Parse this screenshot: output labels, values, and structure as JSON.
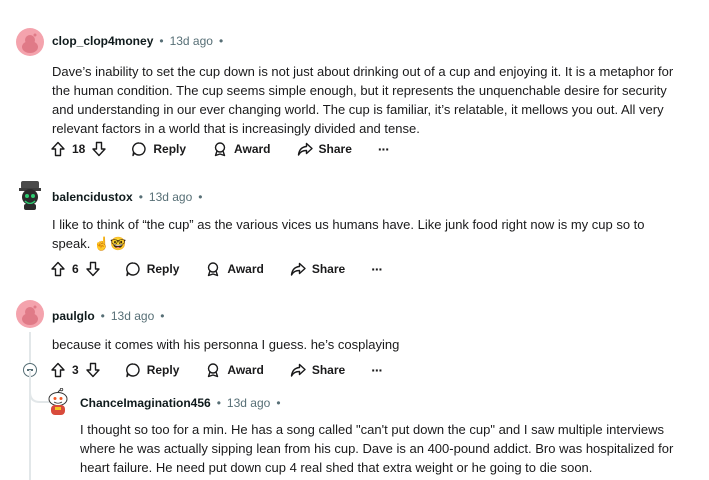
{
  "comments": [
    {
      "author": "clop_clop4money",
      "time": "13d ago",
      "body": "Dave’s inability to set the cup down is not just about drinking out of a cup and enjoying it. It is a metaphor for the human condition. The cup seems simple enough, but it represents the unquenchable desire for security and understanding in our ever changing world. The cup is familiar, it’s relatable, it mellows you out. All very relevant factors in a world that is increasingly divided and tense.",
      "votes": "18",
      "reply": "Reply",
      "award": "Award",
      "share": "Share",
      "more": "···"
    },
    {
      "author": "balencidustox",
      "time": "13d ago",
      "body": "I like to think of “the cup” as the various vices us humans have. Like junk food right now is my cup so to speak. ☝️🤓",
      "votes": "6",
      "reply": "Reply",
      "award": "Award",
      "share": "Share",
      "more": "···"
    },
    {
      "author": "paulglo",
      "time": "13d ago",
      "body": "because it comes with his personna I guess. he’s cosplaying",
      "votes": "3",
      "reply": "Reply",
      "award": "Award",
      "share": "Share",
      "more": "···"
    },
    {
      "author": "ChanceImagination456",
      "time": "13d ago",
      "body": "I thought so too for a min. He has a song called \"can't put down the cup\" and I saw multiple interviews where he was actually sipping lean from his cup. Dave is an 400-pound addict. Bro was hospitalized for heart failure. He need put down cup 4 real shed that extra weight or he going to die soon."
    }
  ],
  "separator": "•",
  "colors": {
    "avatar_pink": "#f4a3ad",
    "avatar_dark": "#3d3d3d",
    "avatar_green": "#2ecc71",
    "meta_gray": "#576f76"
  },
  "icons": [
    "upvote-icon",
    "downvote-icon",
    "comment-icon",
    "award-icon",
    "share-icon",
    "collapse-icon"
  ]
}
